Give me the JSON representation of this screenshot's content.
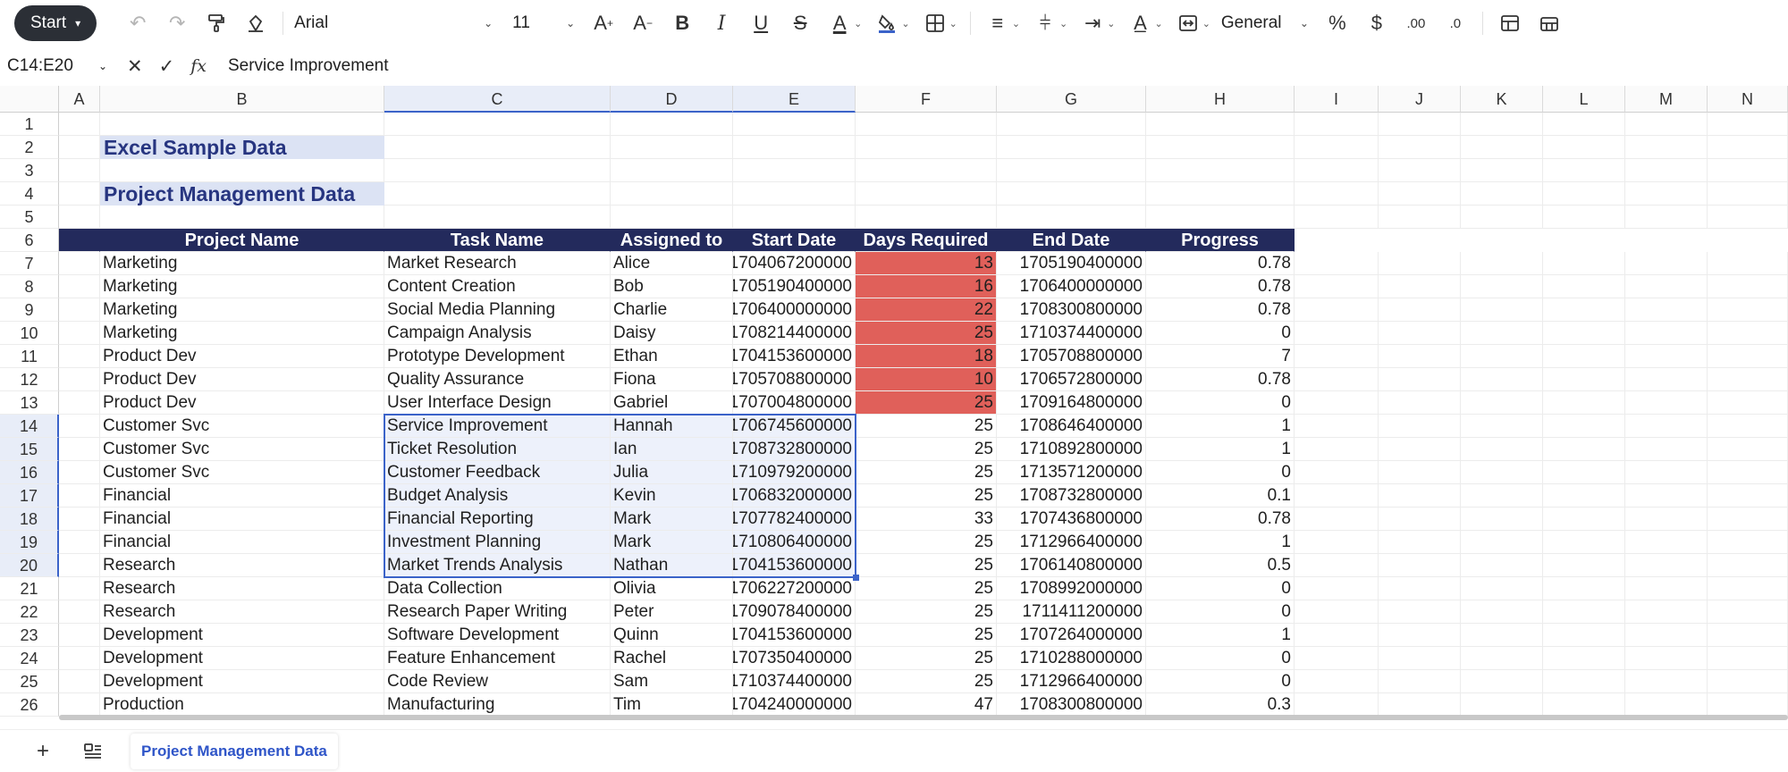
{
  "toolbar": {
    "start_label": "Start",
    "font_name": "Arial",
    "font_size": "11",
    "number_format": "General",
    "icons": [
      "undo-icon",
      "redo-icon",
      "format-painter-icon",
      "clear-format-icon",
      "increase-font-icon",
      "decrease-font-icon",
      "bold-icon",
      "italic-icon",
      "underline-icon",
      "strikethrough-icon",
      "font-color-icon",
      "fill-color-icon",
      "borders-icon",
      "align-icon",
      "vertical-align-icon",
      "text-direction-icon",
      "text-orientation-icon",
      "merge-cells-icon",
      "percent-icon",
      "currency-icon",
      "increase-decimal-icon",
      "decrease-decimal-icon",
      "cell-style-icon",
      "table-style-icon"
    ]
  },
  "formula_bar": {
    "name_box": "C14:E20",
    "formula": "Service Improvement"
  },
  "columns": [
    "A",
    "B",
    "C",
    "D",
    "E",
    "F",
    "G",
    "H",
    "I",
    "J",
    "K",
    "L",
    "M",
    "N"
  ],
  "row_numbers": [
    "1",
    "2",
    "3",
    "4",
    "5",
    "6",
    "7",
    "8",
    "9",
    "10",
    "11",
    "12",
    "13",
    "14",
    "15",
    "16",
    "17",
    "18",
    "19",
    "20",
    "21",
    "22",
    "23",
    "24",
    "25",
    "26"
  ],
  "titles": {
    "main": "Excel Sample Data",
    "sub": "Project Management Data"
  },
  "table": {
    "headers": [
      "Project Name",
      "Task Name",
      "Assigned to",
      "Start Date",
      "Days Required",
      "End Date",
      "Progress"
    ],
    "rows": [
      [
        "Marketing",
        "Market Research",
        "Alice",
        "1704067200000",
        "13",
        "1705190400000",
        "0.78"
      ],
      [
        "Marketing",
        "Content Creation",
        "Bob",
        "1705190400000",
        "16",
        "1706400000000",
        "0.78"
      ],
      [
        "Marketing",
        "Social Media Planning",
        "Charlie",
        "1706400000000",
        "22",
        "1708300800000",
        "0.78"
      ],
      [
        "Marketing",
        "Campaign Analysis",
        "Daisy",
        "1708214400000",
        "25",
        "1710374400000",
        "0"
      ],
      [
        "Product Dev",
        "Prototype Development",
        "Ethan",
        "1704153600000",
        "18",
        "1705708800000",
        "7"
      ],
      [
        "Product Dev",
        "Quality Assurance",
        "Fiona",
        "1705708800000",
        "10",
        "1706572800000",
        "0.78"
      ],
      [
        "Product Dev",
        "User Interface Design",
        "Gabriel",
        "1707004800000",
        "25",
        "1709164800000",
        "0"
      ],
      [
        "Customer Svc",
        "Service Improvement",
        "Hannah",
        "1706745600000",
        "25",
        "1708646400000",
        "1"
      ],
      [
        "Customer Svc",
        "Ticket Resolution",
        "Ian",
        "1708732800000",
        "25",
        "1710892800000",
        "1"
      ],
      [
        "Customer Svc",
        "Customer Feedback",
        "Julia",
        "1710979200000",
        "25",
        "1713571200000",
        "0"
      ],
      [
        "Financial",
        "Budget Analysis",
        "Kevin",
        "1706832000000",
        "25",
        "1708732800000",
        "0.1"
      ],
      [
        "Financial",
        "Financial Reporting",
        "Mark",
        "1707782400000",
        "33",
        "1707436800000",
        "0.78"
      ],
      [
        "Financial",
        "Investment Planning",
        "Mark",
        "1710806400000",
        "25",
        "1712966400000",
        "1"
      ],
      [
        "Research",
        "Market Trends Analysis",
        "Nathan",
        "1704153600000",
        "25",
        "1706140800000",
        "0.5"
      ],
      [
        "Research",
        "Data Collection",
        "Olivia",
        "1706227200000",
        "25",
        "1708992000000",
        "0"
      ],
      [
        "Research",
        "Research Paper Writing",
        "Peter",
        "1709078400000",
        "25",
        "1711411200000",
        "0"
      ],
      [
        "Development",
        "Software Development",
        "Quinn",
        "1704153600000",
        "25",
        "1707264000000",
        "1"
      ],
      [
        "Development",
        "Feature Enhancement",
        "Rachel",
        "1707350400000",
        "25",
        "1710288000000",
        "0"
      ],
      [
        "Development",
        "Code Review",
        "Sam",
        "1710374400000",
        "25",
        "1712966400000",
        "0"
      ],
      [
        "Production",
        "Manufacturing",
        "Tim",
        "1704240000000",
        "47",
        "1708300800000",
        "0.3"
      ]
    ]
  },
  "sheet_tabs": {
    "active": "Project Management Data"
  },
  "colors": {
    "header_bg": "#232a5c",
    "title_bg": "#dce3f4",
    "highlight": "#e0605a",
    "selection": "#3b63c9"
  }
}
